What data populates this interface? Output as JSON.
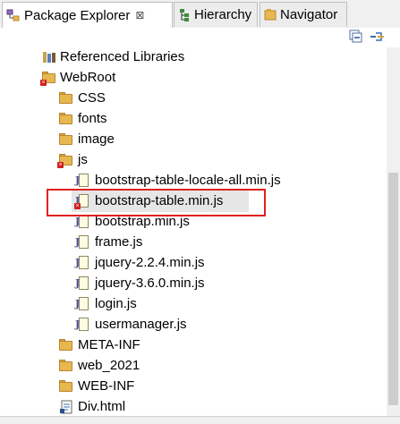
{
  "tabs": [
    {
      "label": "Package Explorer",
      "close": "⊠",
      "icon": "package-explorer-icon",
      "active": true
    },
    {
      "label": "Hierarchy",
      "icon": "hierarchy-icon",
      "active": false
    },
    {
      "label": "Navigator",
      "icon": "navigator-icon",
      "active": false
    }
  ],
  "toolbar": {
    "collapse_icon": "collapse-all-icon",
    "link_icon": "link-with-editor-icon"
  },
  "tree": {
    "items": [
      {
        "label": "Referenced Libraries",
        "icon": "library-icon"
      },
      {
        "label": "WebRoot",
        "icon": "webroot-folder-error-icon"
      },
      {
        "label": "CSS",
        "icon": "folder-icon"
      },
      {
        "label": "fonts",
        "icon": "folder-icon"
      },
      {
        "label": "image",
        "icon": "folder-icon"
      },
      {
        "label": "js",
        "icon": "folder-error-icon"
      },
      {
        "label": "bootstrap-table-locale-all.min.js",
        "icon": "js-file-icon"
      },
      {
        "label": "bootstrap-table.min.js",
        "icon": "js-file-error-icon"
      },
      {
        "label": "bootstrap.min.js",
        "icon": "js-file-icon"
      },
      {
        "label": "frame.js",
        "icon": "js-file-icon"
      },
      {
        "label": "jquery-2.2.4.min.js",
        "icon": "js-file-icon"
      },
      {
        "label": "jquery-3.6.0.min.js",
        "icon": "js-file-icon"
      },
      {
        "label": "login.js",
        "icon": "js-file-icon"
      },
      {
        "label": "usermanager.js",
        "icon": "js-file-icon"
      },
      {
        "label": "META-INF",
        "icon": "folder-icon"
      },
      {
        "label": "web_2021",
        "icon": "folder-icon"
      },
      {
        "label": "WEB-INF",
        "icon": "folder-icon"
      },
      {
        "label": "Div.html",
        "icon": "html-file-icon"
      }
    ]
  },
  "colors": {
    "highlight_box": "#e02020",
    "folder": "#e8b850",
    "error_marker": "#d01e1e"
  }
}
